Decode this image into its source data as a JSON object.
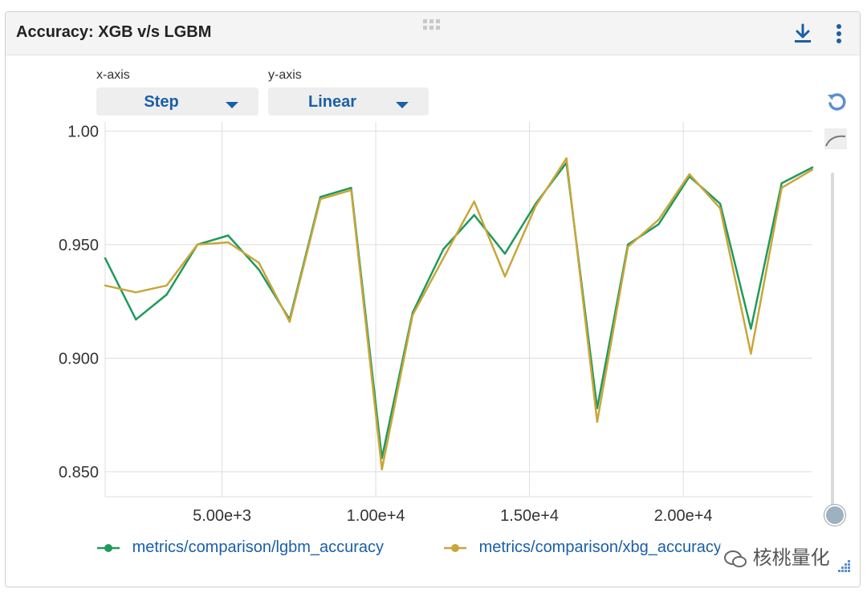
{
  "panel": {
    "title": "Accuracy: XGB v/s LGBM"
  },
  "controls": {
    "x_axis_label": "x-axis",
    "x_axis_value": "Step",
    "y_axis_label": "y-axis",
    "y_axis_value": "Linear"
  },
  "icons": {
    "download": "download-icon",
    "more": "more-vertical-icon",
    "drag": "drag-handle-icon",
    "reset": "reset-icon",
    "smoothing": "smoothing-curve-icon"
  },
  "watermark": "核桃量化",
  "colors": {
    "lgbm": "#1f9a5c",
    "xgb": "#c9a63a",
    "accent": "#1a5fa8",
    "grid": "#dddddd"
  },
  "chart_data": {
    "type": "line",
    "title": "Accuracy: XGB v/s LGBM",
    "xlabel": "",
    "ylabel": "",
    "xlim": [
      1200,
      24200
    ],
    "ylim": [
      0.839,
      1.004
    ],
    "x_ticks": [
      5000,
      10000,
      15000,
      20000
    ],
    "x_tick_labels": [
      "5.00e+3",
      "1.00e+4",
      "1.50e+4",
      "2.00e+4"
    ],
    "y_ticks": [
      1.0,
      0.95,
      0.9,
      0.85
    ],
    "y_tick_labels": [
      "1.00",
      "0.950",
      "0.900",
      "0.850"
    ],
    "grid": true,
    "legend_position": "bottom",
    "series": [
      {
        "name": "metrics/comparison/lgbm_accuracy",
        "color": "#1f9a5c",
        "x": [
          1200,
          2200,
          3200,
          4200,
          5200,
          6200,
          7200,
          8200,
          9200,
          10200,
          11200,
          12200,
          13200,
          14200,
          15200,
          16200,
          17200,
          18200,
          19200,
          20200,
          21200,
          22200,
          23200,
          24200
        ],
        "y": [
          0.944,
          0.917,
          0.928,
          0.95,
          0.954,
          0.939,
          0.917,
          0.971,
          0.975,
          0.856,
          0.92,
          0.948,
          0.963,
          0.946,
          0.968,
          0.986,
          0.878,
          0.95,
          0.959,
          0.98,
          0.968,
          0.913,
          0.977,
          0.984
        ]
      },
      {
        "name": "metrics/comparison/xbg_accuracy",
        "color": "#c9a63a",
        "x": [
          1200,
          2200,
          3200,
          4200,
          5200,
          6200,
          7200,
          8200,
          9200,
          10200,
          11200,
          12200,
          13200,
          14200,
          15200,
          16200,
          17200,
          18200,
          19200,
          20200,
          21200,
          22200,
          23200,
          24200
        ],
        "y": [
          0.932,
          0.929,
          0.932,
          0.95,
          0.951,
          0.942,
          0.916,
          0.97,
          0.974,
          0.851,
          0.919,
          0.944,
          0.969,
          0.936,
          0.967,
          0.988,
          0.872,
          0.949,
          0.961,
          0.981,
          0.966,
          0.902,
          0.975,
          0.983
        ]
      }
    ]
  }
}
